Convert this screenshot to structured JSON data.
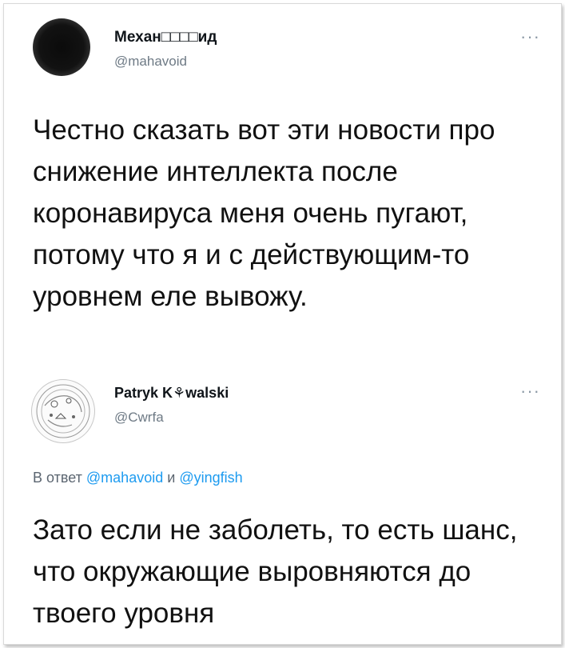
{
  "tweet1": {
    "name": "Механ□□□□ид",
    "handle": "@mahavoid",
    "more": "···",
    "text": "Честно сказать вот эти новости про снижение интеллекта после коронавируса меня очень пугают, потому что я и с действующим-то уровнем еле вывожу."
  },
  "tweet2": {
    "name": "Patryk K⚘walski",
    "handle": "@Cwrfa",
    "more": "···",
    "reply_prefix": "В ответ",
    "reply_to_1": "@mahavoid",
    "reply_and": "и",
    "reply_to_2": "@yingfish",
    "text": "Зато если не заболеть, то есть шанс, что окружающие выровняются до твоего уровня"
  },
  "colors": {
    "link": "#1d9bf0",
    "muted": "#6e7a85",
    "text": "#0f1419"
  },
  "icons": {
    "more": "more-horizontal-icon"
  }
}
